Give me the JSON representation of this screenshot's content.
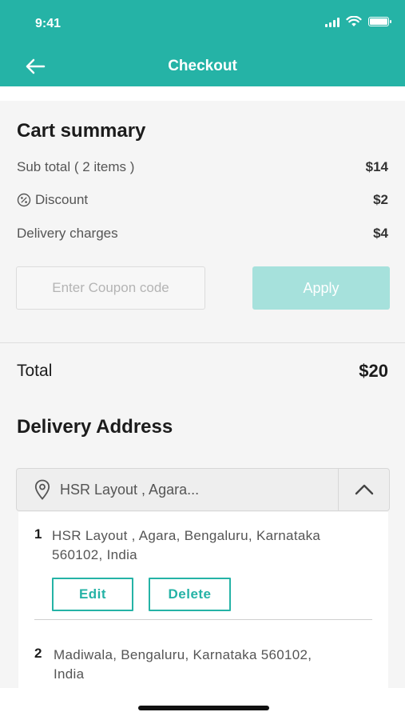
{
  "status_bar": {
    "time": "9:41"
  },
  "nav": {
    "title": "Checkout"
  },
  "cart_summary": {
    "title": "Cart summary",
    "rows": [
      {
        "label": "Sub total ( 2 items )",
        "value": "$14"
      },
      {
        "label": "Discount",
        "value": "$2"
      },
      {
        "label": "Delivery charges",
        "value": "$4"
      }
    ],
    "coupon": {
      "value": "",
      "placeholder": "Enter Coupon code"
    },
    "apply_label": "Apply"
  },
  "total": {
    "label": "Total",
    "value": "$20"
  },
  "delivery": {
    "title": "Delivery Address",
    "selected": "HSR Layout , Agara...",
    "addresses": [
      {
        "number": "1",
        "text": "HSR Layout , Agara, Bengaluru, Karnataka 560102, India",
        "edit_label": "Edit",
        "delete_label": "Delete"
      },
      {
        "number": "2",
        "text": "Madiwala, Bengaluru, Karnataka 560102, India"
      }
    ]
  },
  "icons": {
    "back": "arrow-left-icon",
    "discount": "percent-badge-icon",
    "location": "location-pin-icon",
    "toggle": "chevron-up-icon"
  },
  "colors": {
    "primary": "#25b3a6",
    "apply_disabled": "#a6e1dc",
    "background": "#f5f5f5"
  }
}
